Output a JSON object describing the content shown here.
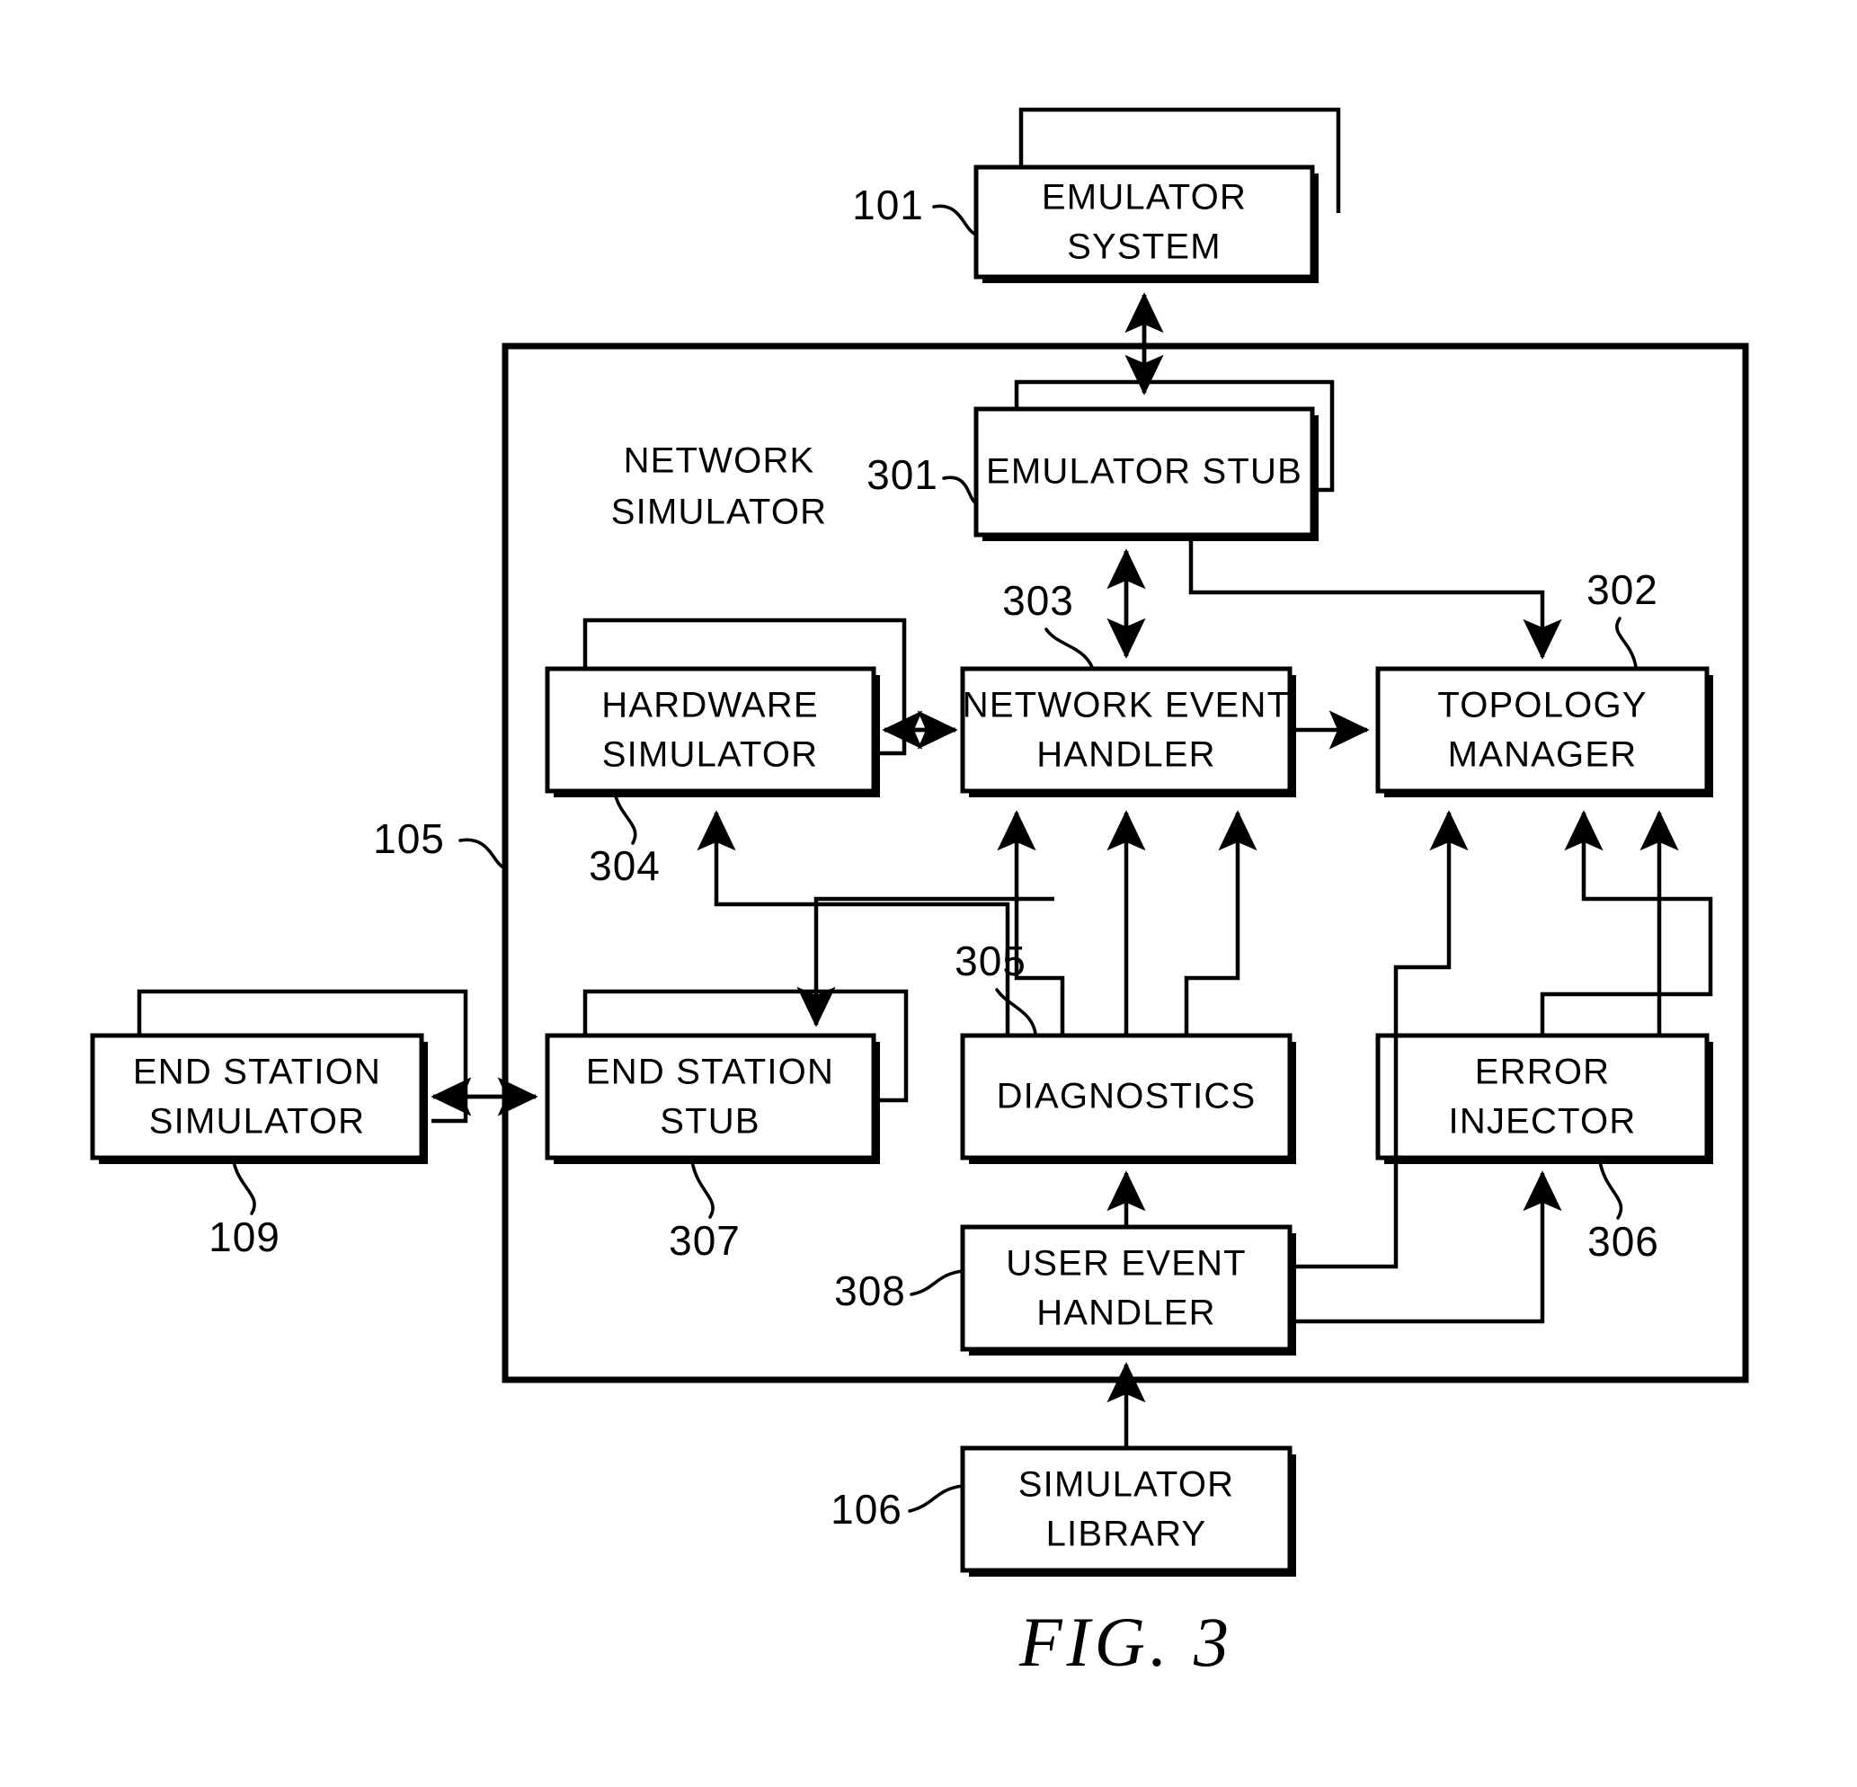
{
  "figure": {
    "caption": "FIG.  3",
    "container_label_line1": "NETWORK",
    "container_label_line2": "SIMULATOR"
  },
  "boxes": {
    "emulator_system": {
      "line1": "EMULATOR",
      "line2": "SYSTEM",
      "ref": "101"
    },
    "emulator_stub": {
      "line1": "EMULATOR  STUB",
      "line2": "",
      "ref": "301"
    },
    "hardware_simulator": {
      "line1": "HARDWARE",
      "line2": "SIMULATOR",
      "ref": "304"
    },
    "network_event_handler": {
      "line1": "NETWORK  EVENT",
      "line2": "HANDLER",
      "ref": "303"
    },
    "topology_manager": {
      "line1": "TOPOLOGY",
      "line2": "MANAGER",
      "ref": "302"
    },
    "end_station_simulator": {
      "line1": "END  STATION",
      "line2": "SIMULATOR",
      "ref": "109"
    },
    "end_station_stub": {
      "line1": "END  STATION",
      "line2": "STUB",
      "ref": "307"
    },
    "diagnostics": {
      "line1": "DIAGNOSTICS",
      "line2": "",
      "ref": "305"
    },
    "error_injector": {
      "line1": "ERROR",
      "line2": "INJECTOR",
      "ref": "306"
    },
    "user_event_handler": {
      "line1": "USER  EVENT",
      "line2": "HANDLER",
      "ref": "308"
    },
    "simulator_library": {
      "line1": "SIMULATOR",
      "line2": "LIBRARY",
      "ref": "106"
    }
  },
  "container": {
    "ref": "105"
  },
  "colors": {
    "ink": "#000000",
    "paper": "#ffffff"
  }
}
